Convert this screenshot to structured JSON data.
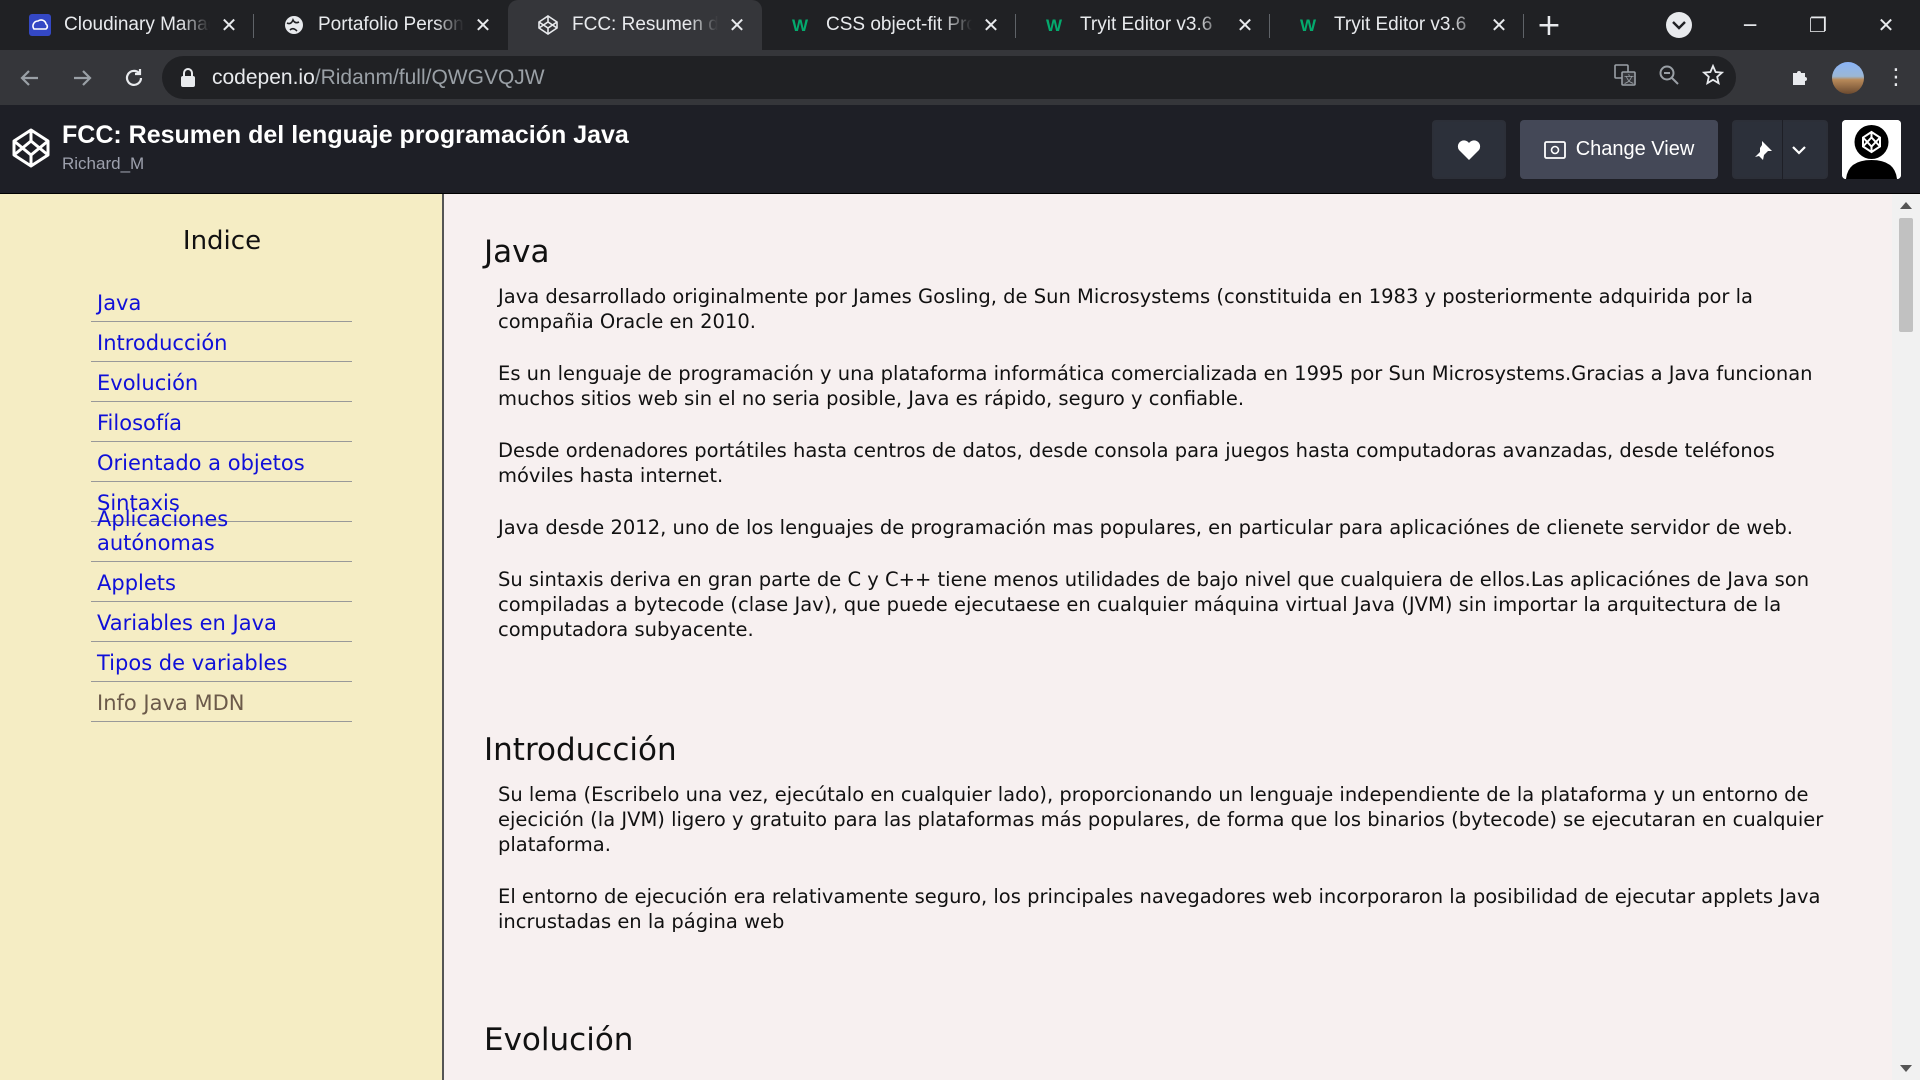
{
  "browser": {
    "tabs": [
      {
        "title": "Cloudinary Management Console",
        "icon": "cloudinary-icon",
        "active": false
      },
      {
        "title": "Portafolio Personal",
        "icon": "globe-icon",
        "active": false
      },
      {
        "title": "FCC: Resumen del lenguaje programación Java",
        "icon": "codepen-icon",
        "active": true
      },
      {
        "title": "CSS object-fit Property",
        "icon": "w3schools-icon",
        "active": false
      },
      {
        "title": "Tryit Editor v3.6",
        "icon": "w3schools-icon",
        "active": false
      },
      {
        "title": "Tryit Editor v3.6",
        "icon": "w3schools-icon",
        "active": false
      }
    ],
    "url_host": "codepen.io",
    "url_path": "/Ridanm/full/QWGVQJW"
  },
  "codepen": {
    "title": "FCC: Resumen del lenguaje programación Java",
    "author": "Richard_M",
    "change_view_label": "Change View"
  },
  "sidebar": {
    "heading": "Indice",
    "items": [
      {
        "label": "Java"
      },
      {
        "label": "Introducción"
      },
      {
        "label": "Evolución"
      },
      {
        "label": "Filosofía"
      },
      {
        "label": "Orientado a objetos"
      },
      {
        "label": "Sintaxis"
      },
      {
        "label": "Aplicaciones autónomas"
      },
      {
        "label": "Applets"
      },
      {
        "label": "Variables en Java"
      },
      {
        "label": "Tipos de variables"
      },
      {
        "label": "Info Java MDN"
      }
    ]
  },
  "main": {
    "sections": [
      {
        "heading": "Java",
        "paragraphs": [
          "Java desarrollado originalmente por James Gosling, de Sun Microsystems (constituida en 1983 y posteriormente adquirida por la compañia Oracle en 2010.",
          "Es un lenguaje de programación y una plataforma informática comercializada en 1995 por Sun Microsystems.Gracias a Java funcionan muchos sitios web sin el no seria posible, Java es rápido, seguro y confiable.",
          "Desde ordenadores portátiles hasta centros de datos, desde consola para juegos hasta computadoras avanzadas, desde teléfonos móviles hasta internet.",
          "Java desde 2012, uno de los lenguajes de programación mas populares, en particular para aplicaciónes de clienete servidor de web.",
          "Su sintaxis deriva en gran parte de C y C++ tiene menos utilidades de bajo nivel que cualquiera de ellos.Las aplicaciónes de Java son compiladas a bytecode (clase Jav), que puede ejecutaese en cualquier máquina virtual Java (JVM) sin importar la arquitectura de la computadora subyacente."
        ]
      },
      {
        "heading": "Introducción",
        "paragraphs": [
          "Su lema (Escribelo una vez, ejecútalo en cualquier lado), proporcionando un lenguaje independiente de la plataforma y un entorno de ejecición (la JVM) ligero y gratuito para las plataformas más populares, de forma que los binarios (bytecode) se ejecutaran en cualquier plataforma.",
          "El entorno de ejecución era relativamente seguro, los principales navegadores web incorporaron la posibilidad de ejecutar applets Java incrustadas en la página web"
        ]
      },
      {
        "heading": "Evolución",
        "paragraphs": []
      }
    ]
  }
}
